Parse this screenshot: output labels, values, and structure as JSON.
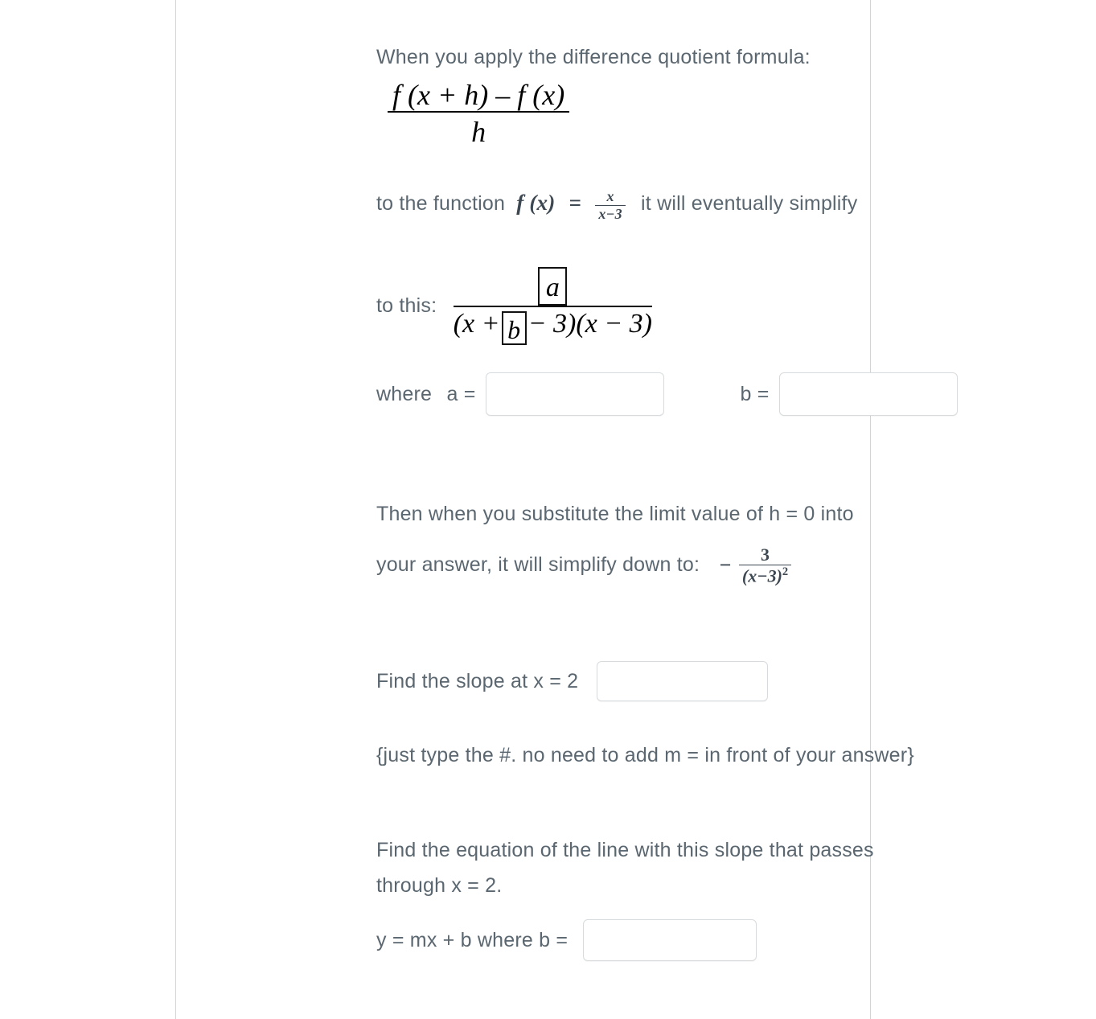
{
  "page": {
    "intro_line": "When you apply the difference quotient formula:",
    "difference_quotient": {
      "numerator": "f (x + h) – f (x)",
      "denominator": "h"
    },
    "function_line": {
      "before": "to the function",
      "f_label": "f (x)",
      "equals": "=",
      "fraction_numerator": "x",
      "fraction_denominator": "x−3",
      "after": "it will eventually simplify"
    },
    "to_this_label": "to this:",
    "simplified": {
      "numerator_box_letter": "a",
      "denominator_prefix": "(x +",
      "denominator_box_letter": "b",
      "denominator_suffix": "− 3)(x − 3)"
    },
    "where_line": {
      "where": "where",
      "a_label": "a =",
      "a_value": "",
      "a_placeholder": "",
      "b_label": "b =",
      "b_value": "",
      "b_placeholder": ""
    },
    "limit_line_1": "Then when you substitute the limit value of h = 0 into",
    "limit_line_2": "your answer, it will simplify down to:",
    "limit_result": {
      "sign": "−",
      "numerator": "3",
      "denominator": "(x−3)",
      "exponent": "2"
    },
    "slope_line": {
      "label": "Find the slope at x = 2",
      "value": "",
      "placeholder": ""
    },
    "slope_note": "{just type the #. no need to add m = in front of your answer}",
    "equation_line_1": "Find the equation of the line with this slope that passes",
    "equation_line_2": "through x = 2.",
    "intercept_line": {
      "label": "y = mx + b where b =",
      "value": "",
      "placeholder": ""
    }
  },
  "colors": {
    "text": "#5b6770",
    "math": "#3d4852",
    "equation_black": "#000000",
    "input_border": "#d8dbdd",
    "frame_rule": "#d2d4d6",
    "background": "#ffffff"
  }
}
